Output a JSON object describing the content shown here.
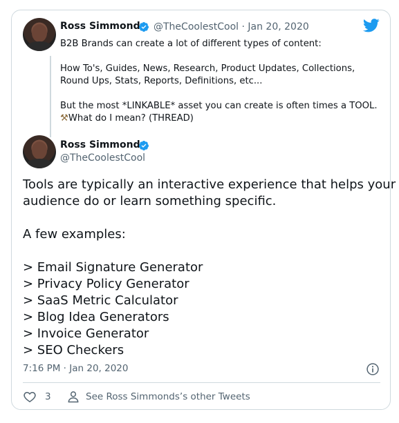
{
  "quoted_tweet": {
    "author_name": "Ross Simmonds",
    "handle": "@TheCoolestCool",
    "separator": "·",
    "date": "Jan 20, 2020",
    "lines": [
      "B2B Brands can create a lot of different types of content:",
      "",
      "How To's, Guides, News, Research, Product Updates, Collections,",
      "Round Ups, Stats, Reports, Definitions, etc...",
      "",
      "But the most *LINKABLE* asset you can create is often times a TOOL.",
      "What do I mean? (THREAD)"
    ],
    "emoji": "⚒"
  },
  "main_tweet": {
    "author_name": "Ross Simmonds",
    "handle": "@TheCoolestCool",
    "lines": [
      "Tools are typically an interactive experience that helps your",
      "audience do or learn something specific.",
      "",
      "A few examples:",
      "",
      "> Email Signature Generator",
      "> Privacy Policy Generator",
      "> SaaS Metric Calculator",
      "> Blog Idea Generators",
      "> Invoice Generator",
      "> SEO Checkers"
    ],
    "timestamp": "7:16 PM · Jan 20, 2020"
  },
  "actions": {
    "like_count": "3",
    "profile_link": "See Ross Simmonds’s other Tweets"
  },
  "icons": {
    "bird": "twitter-bird-icon",
    "verified": "verified-badge-icon",
    "info": "info-icon",
    "heart": "heart-icon",
    "person": "person-icon"
  },
  "colors": {
    "brand_blue": "#1d9bf0",
    "muted": "#536471",
    "text": "#0f1419",
    "border": "#cfd9de"
  }
}
